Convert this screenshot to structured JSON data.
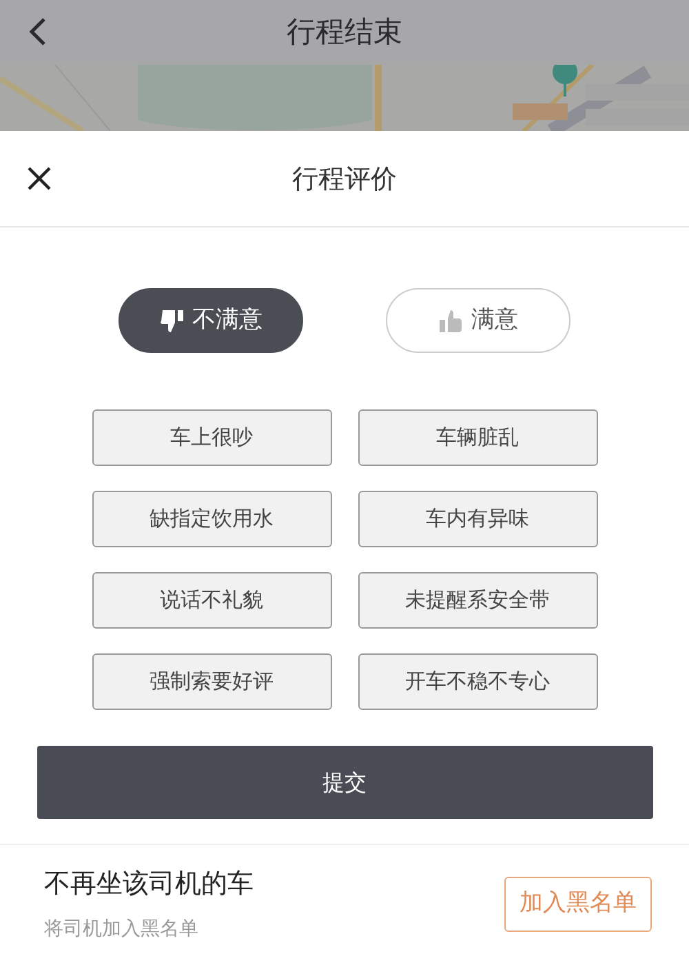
{
  "top_bar": {
    "title": "行程结束"
  },
  "sheet": {
    "title": "行程评价"
  },
  "ratings": [
    {
      "kind": "dislike",
      "label": "不满意",
      "selected": true
    },
    {
      "kind": "like",
      "label": "满意",
      "selected": false
    }
  ],
  "tags": [
    {
      "label": "车上很吵",
      "selected": false
    },
    {
      "label": "车辆脏乱",
      "selected": false
    },
    {
      "label": "缺指定饮用水",
      "selected": false
    },
    {
      "label": "车内有异味",
      "selected": false
    },
    {
      "label": "说话不礼貌",
      "selected": false
    },
    {
      "label": "未提醒系安全带",
      "selected": false
    },
    {
      "label": "强制索要好评",
      "selected": false
    },
    {
      "label": "开车不稳不专心",
      "selected": false
    }
  ],
  "submit_button": "提交",
  "blacklist": {
    "title": "不再坐该司机的车",
    "subtitle": "将司机加入黑名单",
    "button": "加入黑名单"
  }
}
